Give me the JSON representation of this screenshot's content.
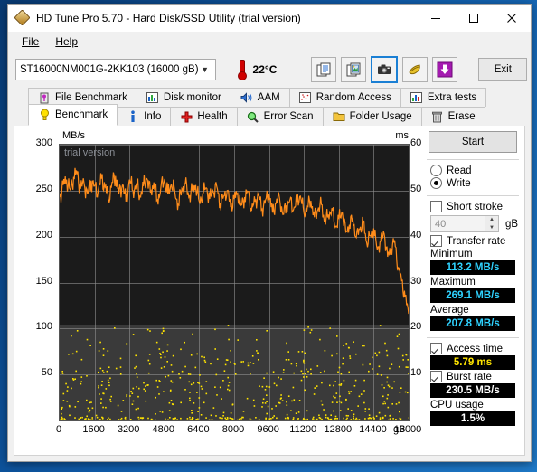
{
  "window": {
    "title": "HD Tune Pro 5.70 - Hard Disk/SSD Utility (trial version)",
    "minimize_label": "–",
    "maximize_label": "□",
    "close_label": "✕"
  },
  "menu": {
    "items": [
      {
        "label": "File"
      },
      {
        "label": "Help"
      }
    ]
  },
  "toolbar": {
    "drive": "ST16000NM001G-2KK103 (16000 gB)",
    "dropdown_icon": "chevron-down-icon",
    "temperature": "22°C",
    "buttons": [
      {
        "name": "copy-text-icon"
      },
      {
        "name": "copy-image-icon"
      },
      {
        "name": "screenshot-camera-icon",
        "selected": true
      },
      {
        "name": "folder-gold-icon"
      },
      {
        "name": "download-arrow-icon"
      }
    ],
    "exit_label": "Exit"
  },
  "tabs": {
    "row1": [
      {
        "label": "File Benchmark",
        "icon": "flask-icon"
      },
      {
        "label": "Disk monitor",
        "icon": "bar-chart-icon"
      },
      {
        "label": "AAM",
        "icon": "speaker-icon"
      },
      {
        "label": "Random Access",
        "icon": "scatter-icon"
      },
      {
        "label": "Extra tests",
        "icon": "grid-chart-icon"
      }
    ],
    "row2": [
      {
        "label": "Benchmark",
        "icon": "bulb-icon",
        "active": true
      },
      {
        "label": "Info",
        "icon": "info-icon"
      },
      {
        "label": "Health",
        "icon": "cross-icon"
      },
      {
        "label": "Error Scan",
        "icon": "magnifier-icon"
      },
      {
        "label": "Folder Usage",
        "icon": "folder-icon"
      },
      {
        "label": "Erase",
        "icon": "trash-icon"
      }
    ]
  },
  "panel": {
    "start_label": "Start",
    "mode_read": "Read",
    "mode_write": "Write",
    "mode_selected": "Write",
    "short_stroke_label": "Short stroke",
    "short_stroke_checked": false,
    "short_stroke_value": "40",
    "short_stroke_unit": "gB",
    "transfer_rate_label": "Transfer rate",
    "transfer_rate_checked": true,
    "minimum_label": "Minimum",
    "minimum_value": "113.2 MB/s",
    "maximum_label": "Maximum",
    "maximum_value": "269.1 MB/s",
    "average_label": "Average",
    "average_value": "207.8 MB/s",
    "access_time_label": "Access time",
    "access_time_checked": true,
    "access_time_value": "5.79 ms",
    "burst_rate_label": "Burst rate",
    "burst_rate_checked": true,
    "burst_rate_value": "230.5 MB/s",
    "cpu_usage_label": "CPU usage",
    "cpu_usage_value": "1.5%",
    "colors": {
      "lcd_cyan": "#2fd2ff",
      "lcd_yellow": "#ffe400",
      "lcd_white": "#ffffff"
    }
  },
  "chart_data": {
    "type": "line",
    "title": "",
    "watermark": "trial version",
    "xlabel": "gB",
    "ylabel": "MB/s",
    "y2label": "ms",
    "xlim": [
      0,
      16000
    ],
    "ylim": [
      0,
      300
    ],
    "y2lim": [
      0,
      60
    ],
    "yticks": [
      300,
      250,
      200,
      150,
      100,
      50
    ],
    "y2ticks": [
      60,
      50,
      40,
      30,
      20,
      10
    ],
    "xticks": [
      0,
      1600,
      3200,
      4800,
      6400,
      8000,
      9600,
      11200,
      12800,
      14400,
      16000
    ],
    "grid": true,
    "legend": "none",
    "background": "#1b1b1b",
    "series": [
      {
        "name": "Transfer rate",
        "type": "line",
        "color": "#ff8c1a",
        "axis": "left",
        "unit": "MB/s",
        "x": [
          0,
          160,
          320,
          480,
          640,
          800,
          960,
          1120,
          1280,
          1440,
          1600,
          1760,
          1920,
          2080,
          2240,
          2400,
          2560,
          2720,
          2880,
          3040,
          3200,
          3360,
          3520,
          3680,
          3840,
          4000,
          4160,
          4320,
          4480,
          4640,
          4800,
          4960,
          5120,
          5280,
          5440,
          5600,
          5760,
          5920,
          6080,
          6240,
          6400,
          6560,
          6720,
          6880,
          7040,
          7200,
          7360,
          7520,
          7680,
          7840,
          8000,
          8160,
          8320,
          8480,
          8640,
          8800,
          8960,
          9120,
          9280,
          9440,
          9600,
          9760,
          9920,
          10080,
          10240,
          10400,
          10560,
          10720,
          10880,
          11040,
          11200,
          11360,
          11520,
          11680,
          11840,
          12000,
          12160,
          12320,
          12480,
          12640,
          12800,
          12960,
          13120,
          13280,
          13440,
          13600,
          13760,
          13920,
          14080,
          14240,
          14400,
          14560,
          14720,
          14880,
          15040,
          15200,
          15360,
          15520,
          15680,
          15840,
          16000
        ],
        "values": [
          243,
          256,
          262,
          251,
          265,
          269,
          252,
          258,
          246,
          261,
          255,
          249,
          263,
          254,
          241,
          259,
          266,
          247,
          256,
          238,
          262,
          250,
          258,
          244,
          255,
          263,
          248,
          259,
          240,
          253,
          261,
          246,
          257,
          249,
          235,
          252,
          258,
          243,
          250,
          256,
          238,
          247,
          253,
          241,
          249,
          255,
          236,
          244,
          250,
          232,
          241,
          247,
          234,
          243,
          249,
          228,
          238,
          245,
          230,
          240,
          246,
          226,
          236,
          242,
          224,
          234,
          240,
          229,
          238,
          244,
          226,
          233,
          239,
          221,
          229,
          235,
          216,
          224,
          231,
          210,
          219,
          226,
          205,
          213,
          220,
          199,
          208,
          215,
          193,
          201,
          209,
          186,
          195,
          203,
          178,
          187,
          196,
          166,
          152,
          134,
          116
        ]
      },
      {
        "name": "Access time",
        "type": "scatter",
        "color": "#ffe400",
        "axis": "right",
        "unit": "ms",
        "mean": 5.79,
        "range": [
          0.3,
          20.0
        ],
        "point_count": 600,
        "note": "Yellow scatter of individual access-time samples across the full capacity, densest near 0-1 ms with a spread up to ~20 ms."
      }
    ]
  }
}
